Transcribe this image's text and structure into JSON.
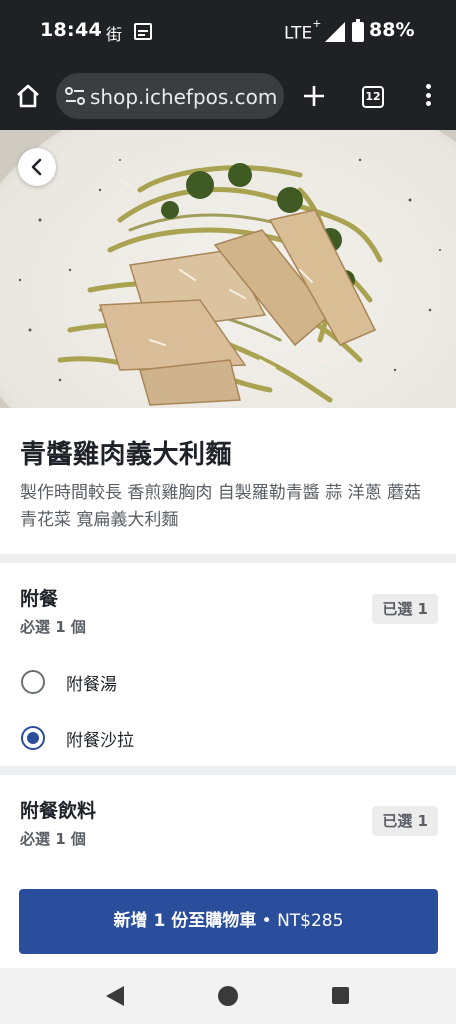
{
  "status_bar": {
    "time": "18:44",
    "carrier_glyph": "街",
    "network": "LTE",
    "network_plus": "+",
    "battery": "88%"
  },
  "browser": {
    "url": "shop.ichefpos.com",
    "tab_count": "12",
    "icons": [
      "home-icon",
      "site-settings-icon",
      "plus-icon",
      "tabs-icon",
      "more-vert-icon"
    ]
  },
  "dish": {
    "name": "青醬雞肉義大利麵",
    "description": "製作時間較長 香煎雞胸肉 自製羅勒青醬 蒜 洋蔥 蘑菇 青花菜 寬扁義大利麵"
  },
  "groups": [
    {
      "title": "附餐",
      "requirement": "必選 1 個",
      "badge": "已選 1",
      "options": [
        {
          "label": "附餐湯",
          "selected": false
        },
        {
          "label": "附餐沙拉",
          "selected": true
        }
      ]
    },
    {
      "title": "附餐飲料",
      "requirement": "必選 1 個",
      "badge": "已選 1",
      "options": []
    }
  ],
  "cart": {
    "label": "新增 1 份至購物車",
    "separator": " • ",
    "price": "NT$285"
  },
  "colors": {
    "primary": "#2b4e9c",
    "toolbar": "#202124",
    "divider": "#eeeff1",
    "badge_bg": "#ececed"
  }
}
